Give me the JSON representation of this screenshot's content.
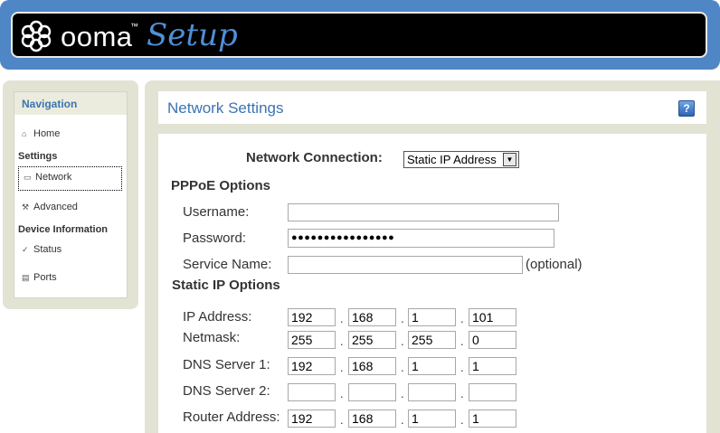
{
  "header": {
    "logo_text": "ooma",
    "logo_tm": "™",
    "app_name": "Setup"
  },
  "nav": {
    "title": "Navigation",
    "home": "Home",
    "settings_heading": "Settings",
    "network": "Network",
    "advanced": "Advanced",
    "device_heading": "Device Information",
    "status": "Status",
    "ports": "Ports"
  },
  "page": {
    "title": "Network Settings",
    "help": "?",
    "connection_label": "Network Connection:",
    "connection_value": "Static IP Address",
    "pppoe_heading": "PPPoE Options",
    "username_label": "Username:",
    "username_value": "",
    "password_label": "Password:",
    "password_value": "●●●●●●●●●●●●●●●●",
    "service_label": "Service Name:",
    "service_value": "",
    "service_hint": "(optional)",
    "static_heading": "Static IP Options",
    "ip_label": "IP Address:",
    "ip": [
      "192",
      "168",
      "1",
      "101"
    ],
    "netmask_label": "Netmask:",
    "netmask": [
      "255",
      "255",
      "255",
      "0"
    ],
    "dns1_label": "DNS Server 1:",
    "dns1": [
      "192",
      "168",
      "1",
      "1"
    ],
    "dns2_label": "DNS Server 2:",
    "dns2": [
      "",
      "",
      "",
      ""
    ],
    "router_label": "Router Address:",
    "router": [
      "192",
      "168",
      "1",
      "1"
    ],
    "separator": "."
  }
}
